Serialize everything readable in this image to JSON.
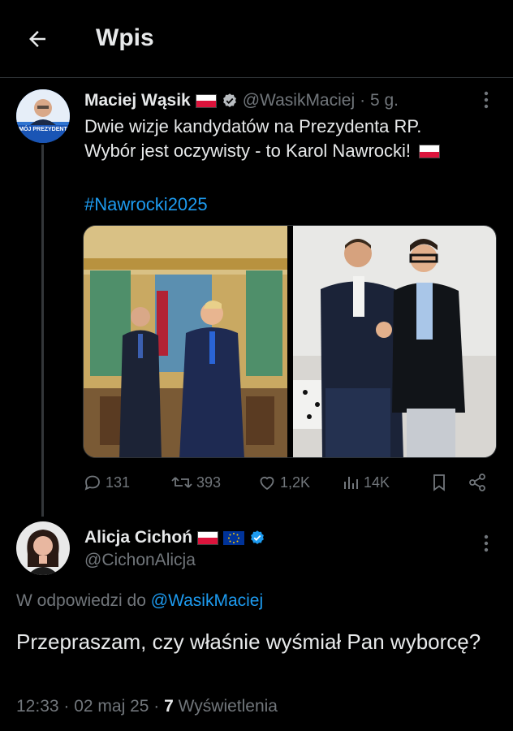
{
  "header": {
    "title": "Wpis"
  },
  "tweet": {
    "author_name": "Maciej Wąsik",
    "handle": "@WasikMaciej",
    "time": "· 5 g.",
    "text_line1": "Dwie wizje kandydatów na Prezydenta RP.",
    "text_line2": "Wybór jest oczywisty - to Karol Nawrocki!",
    "hashtag": "#Nawrocki2025",
    "avatar_banner": "MÓJ PREZYDENT",
    "stats": {
      "replies": "131",
      "reposts": "393",
      "likes": "1,2K",
      "views": "14K"
    }
  },
  "reply": {
    "author_name": "Alicja Cichoń",
    "handle": "@CichonAlicja",
    "reply_prefix": "W odpowiedzi do",
    "reply_handle": "@WasikMaciej",
    "text": "Przepraszam, czy właśnie wyśmiał Pan wyborcę?",
    "time": "12:33 · 02 maj 25 ·",
    "views_count": "7",
    "views_label": "Wyświetlenia"
  },
  "colors": {
    "background": "#000000",
    "text": "#e7e9ea",
    "muted": "#71767b",
    "accent": "#1d9bf0",
    "divider": "#2f3336"
  }
}
